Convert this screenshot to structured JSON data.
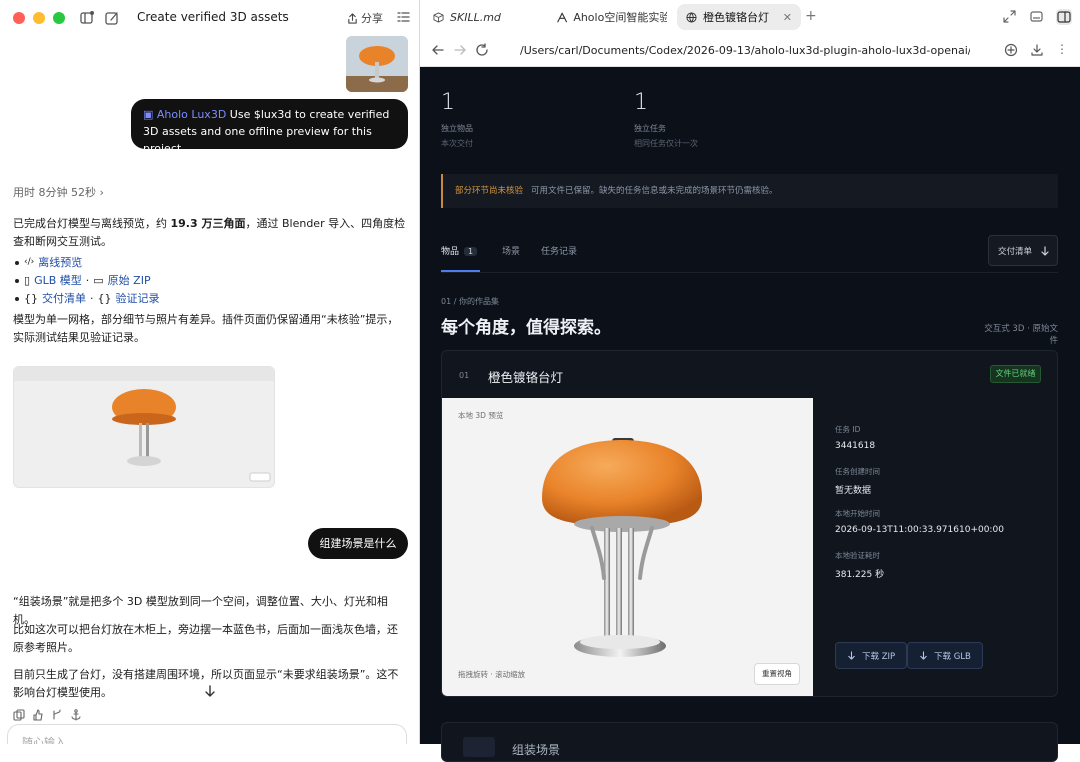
{
  "app": {
    "conversation_title": "Create verified 3D assets",
    "more": "⋯",
    "share_label": "分享"
  },
  "chat": {
    "user_message_1": {
      "tag": "Aholo Lux3D",
      "text": "Use $lux3d to create verified 3D assets and one offline preview for this project."
    },
    "elapsed": "用时 8分钟 52秒",
    "para1_pre": "已完成台灯模型与离线预览，约 ",
    "para1_bold": "19.3 万三角面",
    "para1_post": "，通过 Blender 导入、四角度检查和断网交互测试。",
    "links": {
      "offline_preview": "离线预览",
      "glb_model": "GLB 模型",
      "original_zip": "原始 ZIP",
      "delivery_list": "交付清单",
      "verification_log": "验证记录",
      "sep": "·"
    },
    "para2": "模型为单一网格，部分细节与照片有差异。插件页面仍保留通用“未核验”提示，实际测试结果见验证记录。",
    "user_message_2": "组建场景是什么",
    "para3": "“组装场景”就是把多个 3D 模型放到同一个空间，调整位置、大小、灯光和相机。",
    "para4": "比如这次可以把台灯放在木柜上，旁边摆一本蓝色书，后面加一面浅灰色墙，还原参考照片。",
    "para5": "目前只生成了台灯，没有搭建周围环境，所以页面显示“未要求组装场景”。这不影响台灯模型使用。",
    "composer_placeholder": "随心输入"
  },
  "browser": {
    "tabs": [
      {
        "label": "SKILL.md",
        "icon": "cube-icon"
      },
      {
        "label": "Aholo空间智能实验",
        "icon": "aholo-logo-icon"
      },
      {
        "label": "橙色镀铬台灯",
        "icon": "globe-icon",
        "active": true
      }
    ],
    "url": "/Users/carl/Documents/Codex/2026-09-13/aholo-lux3d-plugin-aholo-lux3d-openai/outputs/orange-chrome-lamp"
  },
  "page": {
    "stats": [
      {
        "value": "1",
        "label": "独立物品",
        "sub": "本次交付"
      },
      {
        "value": "1",
        "label": "独立任务",
        "sub": "相同任务仅计一次"
      }
    ],
    "notice_title": "部分环节尚未核验",
    "notice_text": "可用文件已保留。缺失的任务信息或未完成的场景环节仍需核验。",
    "tabs": {
      "items": "物品",
      "items_count": "1",
      "scene": "场景",
      "task_log": "任务记录"
    },
    "delivery_button": "交付清单",
    "section_kicker": "01 / 你的作品集",
    "section_title": "每个角度，值得探索。",
    "section_meta": "交互式 3D · 原始文件",
    "card": {
      "index": "01",
      "name": "橙色镀铬台灯",
      "badge": "文件已就绪",
      "viewer_label": "本地 3D 预览",
      "viewer_hint": "拖拽旋转 · 滚动缩放",
      "reset_view": "重置视角",
      "meta": [
        {
          "label": "任务 ID",
          "value": "3441618"
        },
        {
          "label": "任务创建时间",
          "value": "暂无数据"
        },
        {
          "label": "本地开始时间",
          "value": "2026-09-13T11:00:33.971610+00:00"
        },
        {
          "label": "本地验证耗时",
          "value": "381.225 秒"
        }
      ],
      "download_zip": "下载 ZIP",
      "download_glb": "下载 GLB"
    },
    "card2_name": "组装场景"
  },
  "colors": {
    "accent_blue": "#4d7cf0",
    "warning": "#d8973d",
    "ready_green": "#5fd27b",
    "lamp_orange": "#e9832a"
  }
}
